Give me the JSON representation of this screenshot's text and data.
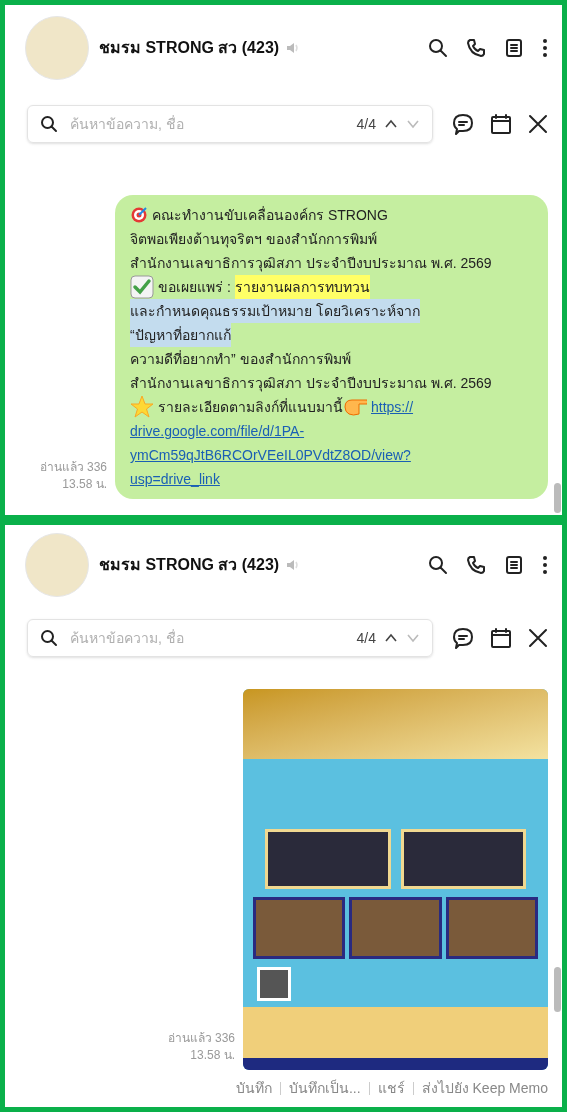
{
  "panels": [
    {
      "header": {
        "title": "ชมรม STRONG สว (423)",
        "muted": true
      },
      "search": {
        "placeholder": "ค้นหาข้อความ, ชื่อ",
        "count": "4/4"
      },
      "message": {
        "kind": "text",
        "read": "อ่านแล้ว 336",
        "time": "13.58 น.",
        "lines": [
          [
            {
              "kind": "icon"
            },
            {
              "kind": "text",
              "text": "คณะทำงานขับเคลื่อนองค์กร STRONG"
            }
          ],
          [
            {
              "kind": "text",
              "text": "จิตพอเพียงต้านทุจริตฯ ของสำนักการพิมพ์"
            }
          ],
          [
            {
              "kind": "text",
              "text": "สำนักงานเลขาธิการวุฒิสภา ประจำปีงบประมาณ พ.ศ. 2569"
            }
          ],
          [
            {
              "kind": "icon"
            },
            {
              "kind": "text",
              "text": "ขอเผยแพร่ : "
            },
            {
              "kind": "text",
              "text": "รายงานผลการทบทวน",
              "color": "#ffff66"
            }
          ],
          [
            {
              "kind": "text",
              "text": "และกำหนดคุณธรรมเป้าหมาย โดยวิเคราะห์จาก",
              "color": "#c3dcee"
            }
          ],
          [
            {
              "kind": "text",
              "text": "“ปัญหาที่อยากแก้",
              "color": "#c3dcee"
            }
          ],
          [
            {
              "kind": "text",
              "text": "ความดีที่อยากทำ” ของสำนักการพิมพ์"
            }
          ],
          [
            {
              "kind": "text",
              "text": "สำนักงานเลขาธิการวุฒิสภา ประจำปีงบประมาณ พ.ศ. 2569"
            }
          ],
          [
            {
              "kind": "icon"
            },
            {
              "kind": "text",
              "text": "รายละเอียดตามลิงก์ที่แนบมานี้"
            },
            {
              "kind": "icon"
            },
            {
              "kind": "link",
              "text": "https://"
            }
          ],
          [
            {
              "kind": "link",
              "text": "drive.google.com/file/d/1PA-"
            }
          ],
          [
            {
              "kind": "link",
              "text": "ymCm59qJtB6RCOrVEeIL0PVdtZ8OD/view?"
            }
          ],
          [
            {
              "kind": "link",
              "text": "usp=drive_link"
            }
          ]
        ]
      }
    },
    {
      "header": {
        "title": "ชมรม STRONG สว (423)",
        "muted": true
      },
      "search": {
        "placeholder": "ค้นหาข้อความ, ชื่อ",
        "count": "4/4"
      },
      "message": {
        "kind": "image",
        "read": "อ่านแล้ว 336",
        "time": "13.58 น."
      },
      "actions": [
        "บันทึก",
        "บันทึกเป็น...",
        "แชร์",
        "ส่งไปยัง Keep Memo"
      ]
    }
  ]
}
